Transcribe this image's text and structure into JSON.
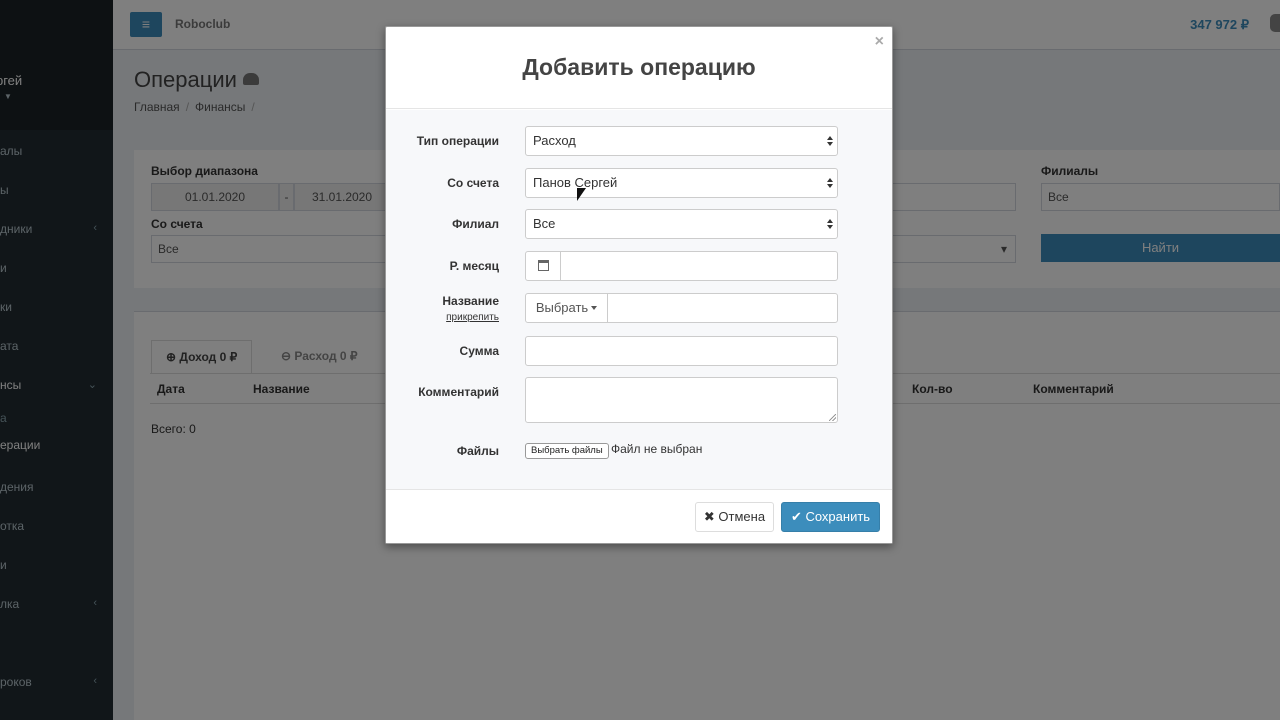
{
  "app": {
    "brand": "Roboclub",
    "balance": "347 972 ₽"
  },
  "sidebar": {
    "user_name": "ргей",
    "items": [
      {
        "label": "алы"
      },
      {
        "label": "ы"
      },
      {
        "label": "дники",
        "chevron": "‹"
      },
      {
        "label": "и"
      },
      {
        "label": "ки"
      },
      {
        "label": "ата"
      },
      {
        "label": "нсы",
        "chevron": "⌄"
      },
      {
        "label": "а"
      },
      {
        "label": "ерации"
      },
      {
        "label": "дения"
      },
      {
        "label": "отка"
      },
      {
        "label": "и"
      },
      {
        "label": "лка",
        "chevron": "‹"
      },
      {
        "label": "роков",
        "chevron": "‹"
      }
    ]
  },
  "page": {
    "title": "Операции",
    "breadcrumb": [
      "Главная",
      "Финансы"
    ],
    "filters": {
      "range_label": "Выбор диапазона",
      "date_from": "01.01.2020",
      "range_sep": "-",
      "date_to": "31.01.2020",
      "account_label": "Со счета",
      "account_value": "Все",
      "branches_label": "Филиалы",
      "branches_value": "Все",
      "find_button": "Найти"
    },
    "tabs": [
      {
        "label": "Доход 0 ₽",
        "icon": "plus-circle-icon"
      },
      {
        "label": "Расход 0 ₽",
        "icon": "minus-circle-icon"
      }
    ],
    "table_headers": [
      "Дата",
      "Название",
      "Кол-во",
      "Комментарий"
    ],
    "total": "Всего: 0"
  },
  "modal": {
    "title": "Добавить операцию",
    "close": "×",
    "fields": {
      "type_label": "Тип операции",
      "type_value": "Расход",
      "account_label": "Со счета",
      "account_value": "Панов Сергей",
      "branch_label": "Филиал",
      "branch_value": "Все",
      "month_label": "Р. месяц",
      "name_label": "Название",
      "name_attach": "прикрепить",
      "name_choose": "Выбрать",
      "sum_label": "Сумма",
      "comment_label": "Комментарий",
      "files_label": "Файлы",
      "files_button": "Выбрать файлы",
      "files_status": "Файл не выбран"
    },
    "cancel_label": "Отмена",
    "save_label": "Сохранить"
  },
  "colors": {
    "primary": "#3c8dbc",
    "sidebar": "#222d32"
  }
}
